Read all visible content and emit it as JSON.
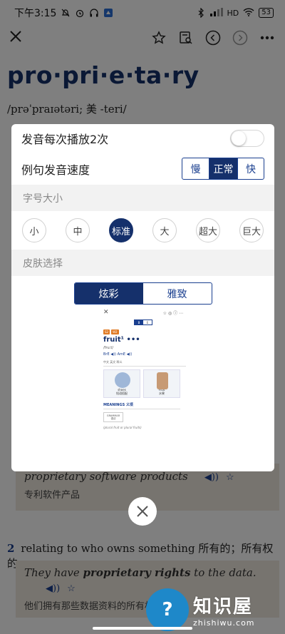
{
  "status_bar": {
    "time": "下午3:15",
    "network": "HD",
    "battery": "53"
  },
  "entry": {
    "headword": "pro·pri·e·ta·ry",
    "pronunciation": "/prəˈpraɪətəri; 美 -teri/",
    "sense1_example_en": "proprietary software products",
    "sense1_example_zh": "专利软件产品",
    "sense2_number": "2",
    "sense2_text": "relating to who owns something 所有的；所有权的",
    "sense2_example_en_pre": "They have ",
    "sense2_example_en_bold": "proprietary rights",
    "sense2_example_en_post": " to the data.",
    "sense2_example_zh": "他们拥有那些数据资料的所有权"
  },
  "settings": {
    "auto_play_label": "发音每次播放2次",
    "speed_label": "例句发音速度",
    "speed_options": [
      "慢",
      "正常",
      "快"
    ],
    "font_size_header": "字号大小",
    "font_sizes": [
      "小",
      "中",
      "标准",
      "大",
      "超大",
      "巨大"
    ],
    "skin_header": "皮肤选择",
    "skin_options": [
      "炫彩",
      "雅致"
    ]
  },
  "preview": {
    "seg": [
      "B",
      "E"
    ],
    "badge1": "S2",
    "badge2": "W2",
    "word": "fruit¹ •••",
    "pron": "/fruːt/",
    "pron_line": "BrE ◀))  AmE ◀))",
    "tabs": "中文  英文  释义",
    "card1": "shoes",
    "card1_sub": "短语搭配",
    "card2": "Fruit",
    "card2_sub": "水果",
    "meanings": "MEANINGS 义项",
    "grammar": "GRAMMAR",
    "grammar_sub": "语法",
    "footer": "(plural fruit or plural fruits)"
  },
  "watermark": {
    "title": "知识屋",
    "sub": "zhishiwu.com",
    "logo": "?"
  },
  "colors": {
    "accent": "#15306b",
    "overlay": "rgba(0,0,0,0.5)"
  }
}
